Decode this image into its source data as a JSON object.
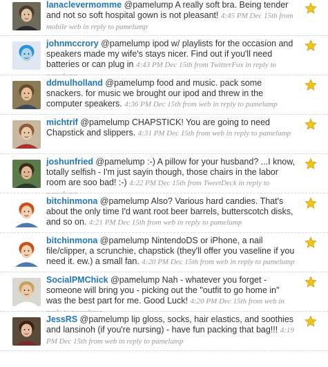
{
  "tweets": [
    {
      "user": "lanaclevermomme",
      "text": "@pamelump A really soft bra. Being tender and not so soft hospital gown is not pleasant!",
      "time": "4:45 PM Dec 15th",
      "source_prefix": "from",
      "source": "mobile web",
      "reply_text": "in reply to pamelump",
      "avatar_colors": {
        "bg": "#6e6a5a",
        "face": "#e2c3a3",
        "hair": "#4a3a2a",
        "shirt": "#2a2a2a"
      }
    },
    {
      "user": "johnmccrory",
      "text": "@pamelump ipod w/ playlists for the occasion and speakers made my wife's stays nicer. Find out if you'll need batteries or can plug in",
      "time": "4:43 PM Dec 15th",
      "source_prefix": "from",
      "source": "TwitterFox",
      "reply_text": "in reply to pamelump",
      "avatar_colors": {
        "bg": "#dfe8f2",
        "face": "#a9d7f0",
        "hair": "#2f8fd6",
        "shirt": "#dfe8f2"
      }
    },
    {
      "user": "ddmulholland",
      "text": "@pamelump food and music. pack some snackers. for music we brought our ipod and threw in the computer speakers.",
      "time": "4:36 PM Dec 15th",
      "source_prefix": "from",
      "source": "web",
      "reply_text": "in reply to pamelump",
      "avatar_colors": {
        "bg": "#8a7a55",
        "face": "#e8c09a",
        "hair": "#6a4a2a",
        "shirt": "#3a4a5a"
      }
    },
    {
      "user": "michtrif",
      "text": "@pamelump CHAPSTICK! You are going to need Chapstick and slippers.",
      "time": "4:31 PM Dec 15th",
      "source_prefix": "from",
      "source": "web",
      "reply_text": "in reply to pamelump",
      "avatar_colors": {
        "bg": "#c8b8a0",
        "face": "#eac8a8",
        "hair": "#8a5a3a",
        "shirt": "#b0302a"
      }
    },
    {
      "user": "joshunfried",
      "text": "@pamelump :-) A pillow for your husband? ...I know, totally selfish - I'm just sayin though, those chairs in the labor room are soo bad! :-)",
      "time": "4:22 PM Dec 15th",
      "source_prefix": "from",
      "source": "TweetDeck",
      "reply_text": "in reply to pamelump",
      "avatar_colors": {
        "bg": "#5a7a4a",
        "face": "#e0b894",
        "hair": "#3a2a1a",
        "shirt": "#2a3a2a"
      }
    },
    {
      "user": "bitchinmona",
      "text": "@pamelump Also? Various hard candies. That's about the only time I'd want root beer barrels, butterscotch disks, and so on.",
      "time": "4:21 PM Dec 15th",
      "source_prefix": "from",
      "source": "web",
      "reply_text": "in reply to pamelump",
      "avatar_colors": {
        "bg": "#ffffff",
        "face": "#f5d0b0",
        "hair": "#c8501a",
        "shirt": "#4a7ab0"
      }
    },
    {
      "user": "bitchinmona",
      "text": "@pamelump NintendoDS or iPhone, a nail file/clipper, a scrunchie, chapstick (they'll offer you vaseline if you need it. ew.) a small fan.",
      "time": "4:20 PM Dec 15th",
      "source_prefix": "from",
      "source": "web",
      "reply_text": "in reply to pamelump",
      "avatar_colors": {
        "bg": "#ffffff",
        "face": "#f5d0b0",
        "hair": "#c8501a",
        "shirt": "#4a7ab0"
      }
    },
    {
      "user": "SocialPMChick",
      "text": "@pamelump Nah - whatever you forget - someone will bring you - picking out the \"outfit to go home in\" was the best part for me. Good Luck!",
      "time": "4:20 PM Dec 15th",
      "source_prefix": "from",
      "source": "web",
      "reply_text": "in reply to pamelump",
      "avatar_colors": {
        "bg": "#d8d8d0",
        "face": "#eccaa8",
        "hair": "#c8a060",
        "shirt": "#ffffff"
      }
    },
    {
      "user": "JessRS",
      "text": "@pamelump lip gloss, socks, hair elastics, and soothies and lansinoh (if you're nursing) - have fun packing that bag!!!",
      "time": "4:19 PM Dec 15th",
      "source_prefix": "from",
      "source": "web",
      "reply_text": "in reply to pamelump",
      "avatar_colors": {
        "bg": "#5a4a3a",
        "face": "#e8c0a0",
        "hair": "#3a2418",
        "shirt": "#7a2a2a"
      }
    }
  ],
  "star_color": "#f0c419",
  "star_stroke": "#c89a08",
  "link_color": "#2276bb"
}
